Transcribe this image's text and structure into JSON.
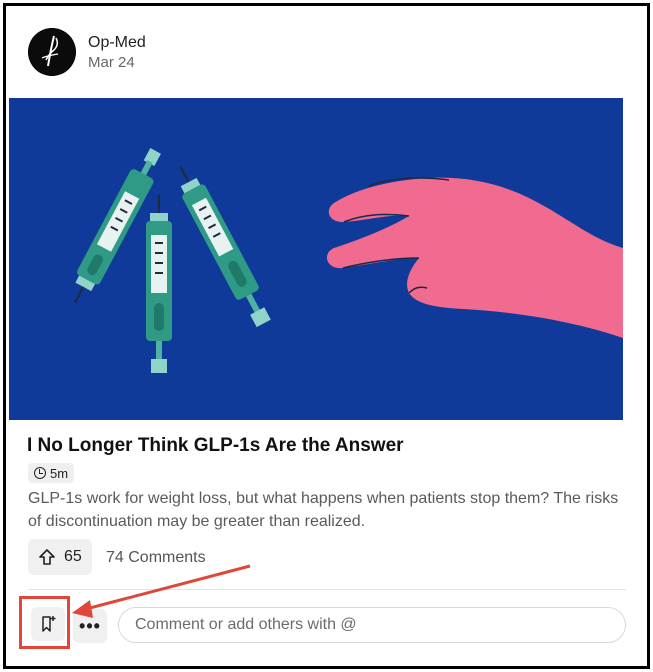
{
  "post": {
    "author": "Op-Med",
    "date": "Mar 24",
    "title": "I No Longer Think GLP-1s Are the Answer",
    "read_time": "5m",
    "description": "GLP-1s work for weight loss, but what happens when patients stop them? The risks of discontinuation may be greater than realized.",
    "upvotes": "65",
    "comments_label": "74 Comments"
  },
  "actions": {
    "bookmark_icon": "bookmark-add-icon",
    "more_label": "•••",
    "comment_placeholder": "Comment or add others with @"
  },
  "colors": {
    "hero_background": "#0f3a9a",
    "highlight": "#e0463a",
    "hand": "#f06b8f",
    "syringe": "#2f9a86"
  }
}
